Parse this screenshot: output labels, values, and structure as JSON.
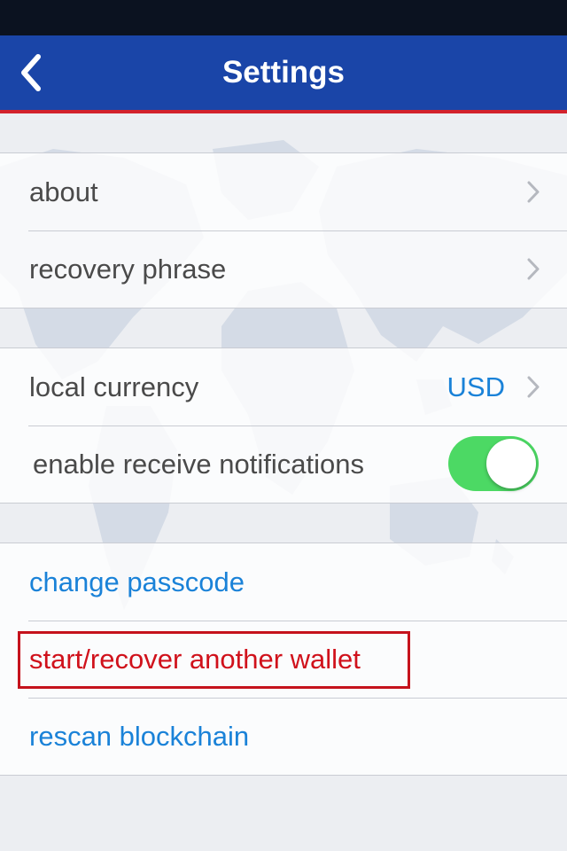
{
  "nav": {
    "title": "Settings",
    "back_icon": "chevron-left-icon"
  },
  "groups": {
    "info": {
      "about_label": "about",
      "recovery_label": "recovery phrase"
    },
    "preferences": {
      "currency_label": "local currency",
      "currency_value": "USD",
      "notifications_label": "enable receive notifications",
      "notifications_enabled": true
    },
    "actions": {
      "change_passcode_label": "change passcode",
      "start_recover_label": "start/recover another wallet",
      "rescan_label": "rescan blockchain"
    }
  },
  "colors": {
    "nav_background": "#1a45a8",
    "nav_accent": "#d3222c",
    "link": "#1a82d8",
    "danger": "#d0111b",
    "toggle_on": "#4cd964"
  }
}
